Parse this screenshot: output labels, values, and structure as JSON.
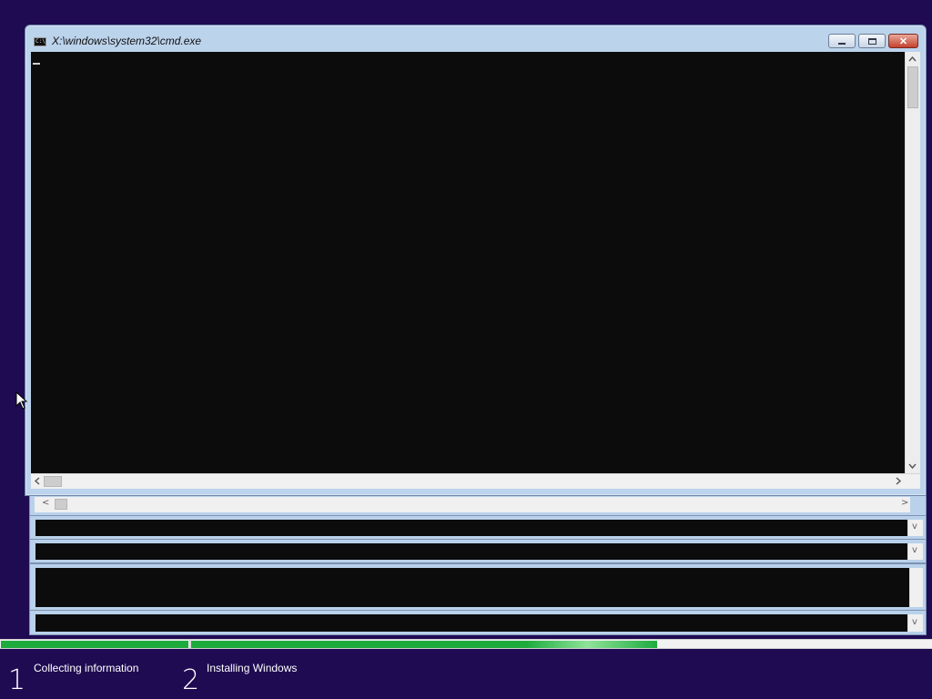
{
  "cmd_window": {
    "title": "X:\\windows\\system32\\cmd.exe",
    "icon": "cmd-icon",
    "icon_text": "C:\\",
    "controls": [
      "minimize-icon",
      "maximize-icon",
      "close-icon"
    ],
    "close_glyph": "✕",
    "scroll_left_glyph": "<",
    "scroll_right_glyph": ">",
    "scroll_up_glyph": "^",
    "scroll_down_glyph": "v"
  },
  "background_windows": {
    "chevron_down": "v",
    "chevron_left": "<",
    "chevron_right": ">"
  },
  "setup_progress": {
    "steps": [
      {
        "number": "1",
        "label": "Collecting information"
      },
      {
        "number": "2",
        "label": "Installing Windows"
      }
    ],
    "step1_fill_fraction": 1.0,
    "step2_fill_fraction": 0.63,
    "accent_color": "#1dab3e",
    "background_color": "#1f0b52"
  }
}
